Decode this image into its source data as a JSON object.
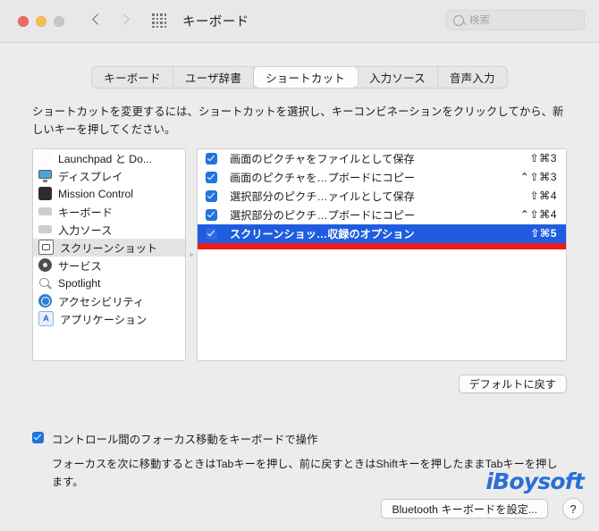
{
  "window": {
    "title": "キーボード",
    "traffic_lights": [
      "close",
      "minimize",
      "zoom"
    ]
  },
  "search": {
    "placeholder": "検索",
    "value": ""
  },
  "tabs": [
    {
      "label": "キーボード",
      "selected": false
    },
    {
      "label": "ユーザ辞書",
      "selected": false
    },
    {
      "label": "ショートカット",
      "selected": true
    },
    {
      "label": "入力ソース",
      "selected": false
    },
    {
      "label": "音声入力",
      "selected": false
    }
  ],
  "instruction": "ショートカットを変更するには、ショートカットを選択し、キーコンビネーションをクリックしてから、新しいキーを押してください。",
  "categories": [
    {
      "label": "Launchpad と Do...",
      "icon": "launchpad-dock-icon",
      "selected": false
    },
    {
      "label": "ディスプレイ",
      "icon": "display-icon",
      "selected": false
    },
    {
      "label": "Mission Control",
      "icon": "mission-control-icon",
      "selected": false
    },
    {
      "label": "キーボード",
      "icon": "keyboard-icon",
      "selected": false
    },
    {
      "label": "入力ソース",
      "icon": "input-source-icon",
      "selected": false
    },
    {
      "label": "スクリーンショット",
      "icon": "screenshot-icon",
      "selected": true
    },
    {
      "label": "サービス",
      "icon": "services-gear-icon",
      "selected": false
    },
    {
      "label": "Spotlight",
      "icon": "spotlight-icon",
      "selected": false
    },
    {
      "label": "アクセシビリティ",
      "icon": "accessibility-icon",
      "selected": false
    },
    {
      "label": "アプリケーション",
      "icon": "applications-icon",
      "selected": false
    }
  ],
  "shortcuts": [
    {
      "label": "画面のピクチャをファイルとして保存",
      "keys": "⇧⌘3",
      "checked": true,
      "selected": false
    },
    {
      "label": "画面のピクチャを…プボードにコピー",
      "keys": "⌃⇧⌘3",
      "checked": true,
      "selected": false
    },
    {
      "label": "選択部分のピクチ…ァイルとして保存",
      "keys": "⇧⌘4",
      "checked": true,
      "selected": false
    },
    {
      "label": "選択部分のピクチ…プボードにコピー",
      "keys": "⌃⇧⌘4",
      "checked": true,
      "selected": false
    },
    {
      "label": "スクリーンショッ…収録のオプション",
      "keys": "⇧⌘5",
      "checked": true,
      "selected": true
    }
  ],
  "buttons": {
    "reset_defaults": "デフォルトに戻す",
    "bluetooth_keyboard": "Bluetooth キーボードを設定...",
    "help": "?"
  },
  "focus": {
    "checkbox_label": "コントロール間のフォーカス移動をキーボードで操作",
    "checked": true,
    "description": "フォーカスを次に移動するときはTabキーを押し、前に戻すときはShiftキーを押したままTabキーを押します。"
  },
  "watermark": "iBoysoft",
  "colors": {
    "accent_blue": "#1f5ce0",
    "checkbox_blue": "#1f75e0",
    "annotation_red": "#ec1c1c",
    "watermark_blue": "#2a6fd6",
    "window_bg": "#ececec"
  }
}
